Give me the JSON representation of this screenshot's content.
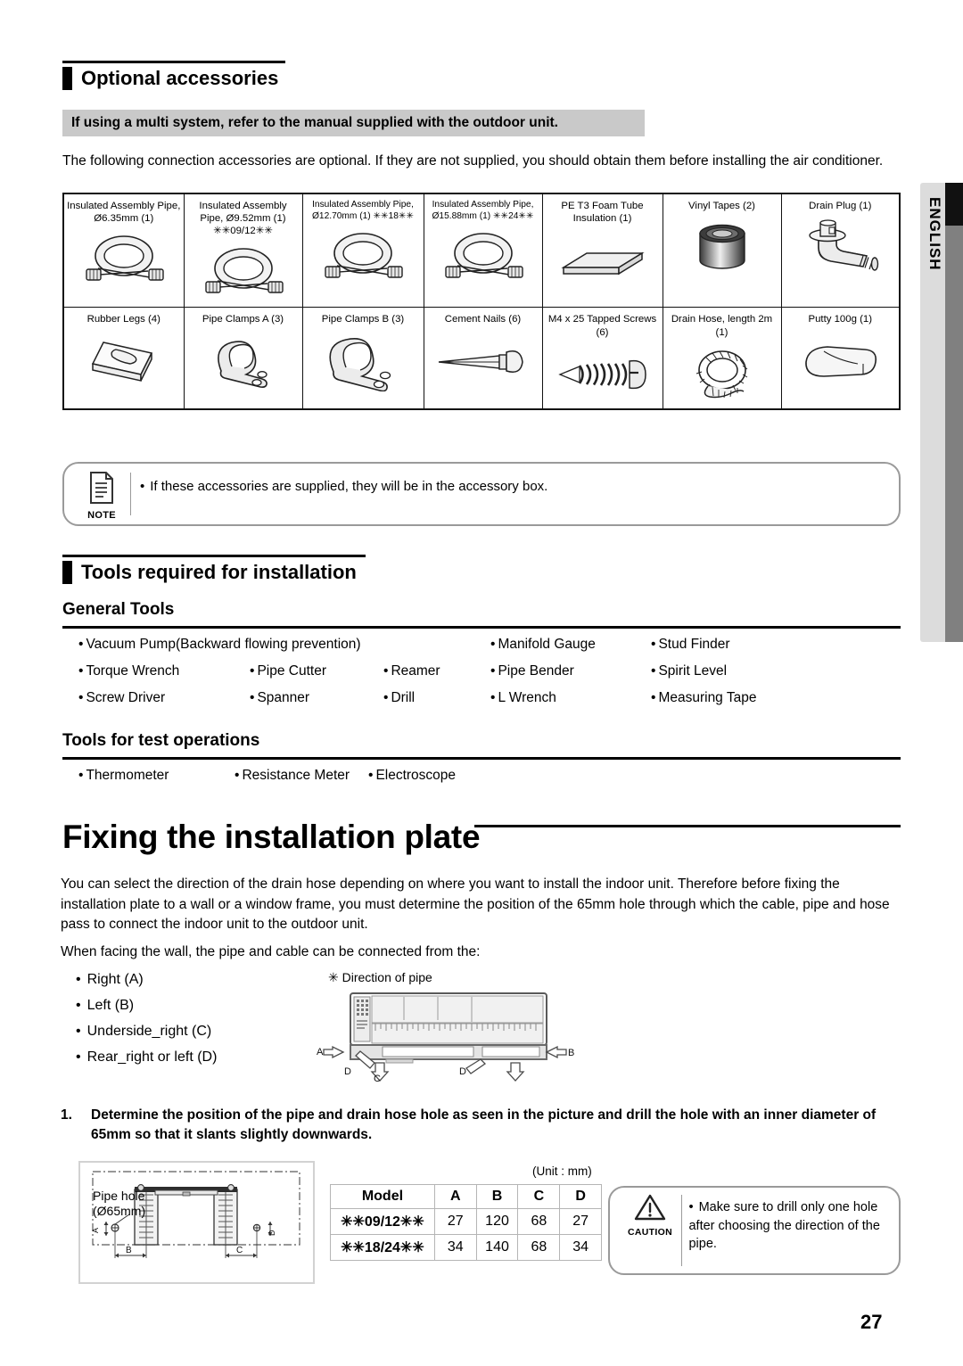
{
  "side_tab": {
    "label": "ENGLISH"
  },
  "page_number": "27",
  "optional_accessories": {
    "heading": "Optional accessories",
    "notice": "If using a multi system, refer to the manual supplied with the outdoor unit.",
    "intro": "The following connection accessories are optional. If they are not supplied, you should obtain them before installing the air conditioner.",
    "rows": [
      [
        {
          "label": "Insulated Assembly Pipe, Ø6.35mm (1)",
          "icon": "coiled-pipe-icon"
        },
        {
          "label": "Insulated Assembly Pipe, Ø9.52mm (1) ✳✳09/12✳✳",
          "icon": "coiled-pipe-icon"
        },
        {
          "label": "Insulated Assembly Pipe, Ø12.70mm (1) ✳✳18✳✳",
          "icon": "coiled-pipe-icon"
        },
        {
          "label": "Insulated Assembly Pipe, Ø15.88mm (1) ✳✳24✳✳",
          "icon": "coiled-pipe-icon"
        },
        {
          "label": "PE T3 Foam Tube Insulation (1)",
          "icon": "foam-sheet-icon"
        },
        {
          "label": "Vinyl Tapes (2)",
          "icon": "tape-roll-icon"
        },
        {
          "label": "Drain Plug (1)",
          "icon": "drain-plug-icon"
        }
      ],
      [
        {
          "label": "Rubber Legs (4)",
          "icon": "rubber-leg-icon"
        },
        {
          "label": "Pipe Clamps A (3)",
          "icon": "pipe-clamp-icon"
        },
        {
          "label": "Pipe Clamps B (3)",
          "icon": "pipe-clamp-icon"
        },
        {
          "label": "Cement Nails (6)",
          "icon": "nail-icon"
        },
        {
          "label": "M4 x 25 Tapped Screws (6)",
          "icon": "screw-icon"
        },
        {
          "label": "Drain Hose, length 2m (1)",
          "icon": "drain-hose-icon"
        },
        {
          "label": "Putty 100g (1)",
          "icon": "putty-icon"
        }
      ]
    ],
    "note": {
      "caption": "NOTE",
      "bullet": "•",
      "text": "If these accessories are supplied, they will be in the accessory box."
    }
  },
  "tools": {
    "heading": "Tools required for installation",
    "general_heading": "General Tools",
    "general_items": [
      "Vacuum Pump(Backward flowing prevention)",
      "",
      "",
      "Manifold Gauge",
      "Stud Finder",
      "Torque Wrench",
      "Pipe Cutter",
      "Reamer",
      "Pipe Bender",
      "Spirit Level",
      "Screw Driver",
      "Spanner",
      "Drill",
      "L Wrench",
      "Measuring Tape"
    ],
    "test_heading": "Tools for test operations",
    "test_items": [
      "Thermometer",
      "Resistance Meter",
      "Electroscope"
    ],
    "bullet": "•"
  },
  "fixing": {
    "title": "Fixing the installation plate",
    "para1": "You can select the direction of the drain hose depending on where you want to install the indoor unit. Therefore before fixing the installation plate to a wall or a window frame, you must determine the position of the 65mm hole through which the cable, pipe and hose pass to connect the indoor unit to the outdoor unit.",
    "para2": "When facing the wall, the pipe and cable can be connected from the:",
    "directions": [
      "Right (A)",
      "Left (B)",
      "Underside_right (C)",
      "Rear_right or left (D)"
    ],
    "bullet": "•",
    "diagram_caption": "✳ Direction of pipe",
    "diagram_labels": {
      "a": "A",
      "b": "B",
      "c": "C",
      "d1": "D",
      "d2": "D"
    },
    "step1_number": "1.",
    "step1_text": "Determine the position of the pipe and drain hose hole as seen in the picture and drill the hole with an inner diameter of 65mm so that it slants slightly downwards.",
    "plate_diagram": {
      "pipe_hole_line1": "Pipe hole",
      "pipe_hole_line2": "(Ø65mm)",
      "dim_a": "A",
      "dim_b": "B",
      "dim_c": "C",
      "dim_d": "D"
    },
    "unit_label": "(Unit : mm)",
    "model_table": {
      "headers": [
        "Model",
        "A",
        "B",
        "C",
        "D"
      ],
      "rows": [
        [
          "✳✳09/12✳✳",
          "27",
          "120",
          "68",
          "27"
        ],
        [
          "✳✳18/24✳✳",
          "34",
          "140",
          "68",
          "34"
        ]
      ]
    },
    "caution": {
      "caption": "CAUTION",
      "bullet": "•",
      "text": "Make sure to drill only one hole after choosing the direction of the pipe."
    }
  }
}
